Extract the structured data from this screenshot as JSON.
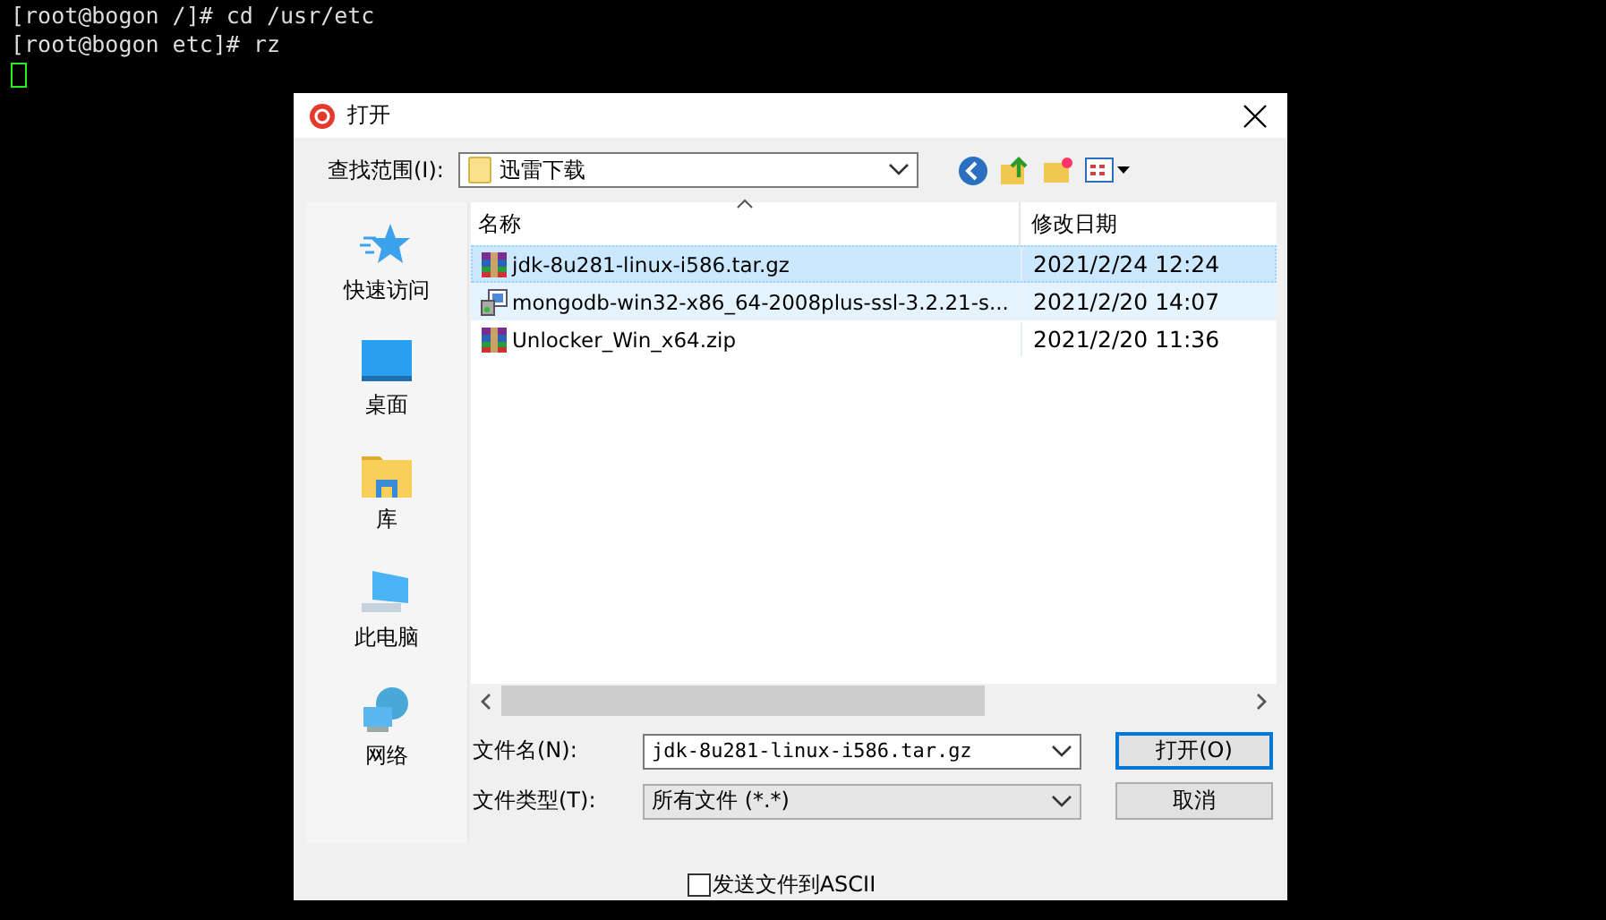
{
  "terminal": {
    "lines": [
      "[root@bogon /]# cd /usr/etc",
      "[root@bogon etc]# rz"
    ]
  },
  "dialog": {
    "title": "打开",
    "look_in": {
      "label": "查找范围(I):",
      "value": "迅雷下载"
    },
    "sidebar": {
      "items": [
        {
          "label": "快速访问",
          "kind": "star",
          "selected": false
        },
        {
          "label": "桌面",
          "kind": "desktop",
          "selected": false
        },
        {
          "label": "库",
          "kind": "library",
          "selected": false
        },
        {
          "label": "此电脑",
          "kind": "computer",
          "selected": false
        },
        {
          "label": "网络",
          "kind": "network",
          "selected": false
        }
      ]
    },
    "file_list": {
      "columns": [
        "名称",
        "修改日期"
      ],
      "rows": [
        {
          "name": "jdk-8u281-linux-i586.tar.gz",
          "date": "2021/2/24 12:24",
          "kind": "archive",
          "selected": true,
          "hovered": false
        },
        {
          "name": "mongodb-win32-x86_64-2008plus-ssl-3.2.21-s...",
          "date": "2021/2/20 14:07",
          "kind": "installer",
          "selected": false,
          "hovered": true
        },
        {
          "name": "Unlocker_Win_x64.zip",
          "date": "2021/2/20 11:36",
          "kind": "archive",
          "selected": false,
          "hovered": false
        }
      ]
    },
    "file_name": {
      "label": "文件名(N):",
      "value": "jdk-8u281-linux-i586.tar.gz"
    },
    "file_type": {
      "label": "文件类型(T):",
      "value": "所有文件 (*.*)"
    },
    "buttons": [
      {
        "label": "打开(O)",
        "default": true
      },
      {
        "label": "取消",
        "default": false
      }
    ],
    "ascii_option": {
      "label": "发送文件到ASCII",
      "checked": false
    }
  }
}
